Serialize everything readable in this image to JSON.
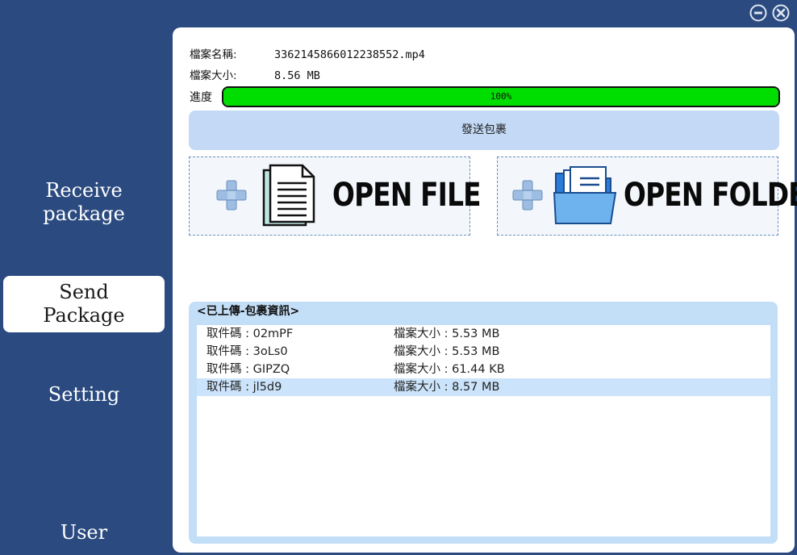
{
  "sidebar": {
    "items": [
      {
        "line1": "Receive",
        "line2": "package"
      },
      {
        "line1": "Send",
        "line2": "Package"
      },
      {
        "line1": "Setting"
      },
      {
        "line1": "User"
      }
    ],
    "active_index": 1
  },
  "window": {
    "minimize_icon": "minus-circle-icon",
    "close_icon": "x-circle-icon"
  },
  "file_info": {
    "name_label": "檔案名稱:",
    "name_value": "3362145866012238552.mp4",
    "size_label": "檔案大小:",
    "size_value": "8.56 MB"
  },
  "progress": {
    "label": "進度",
    "value": 1.0,
    "text": "100%",
    "color": "#00dd00"
  },
  "send_button": {
    "label": "發送包裹"
  },
  "open_file": {
    "label": "OPEN FILE",
    "icon": "document-icon"
  },
  "open_folder": {
    "label": "OPEN FOLDER",
    "icon": "folder-icon"
  },
  "uploaded": {
    "title": "<已上傳-包裹資訊>",
    "rows": [
      {
        "code": "取件碼 : 02mPF",
        "size": "檔案大小 : 5.53 MB"
      },
      {
        "code": "取件碼 : 3oLs0",
        "size": "檔案大小 : 5.53 MB"
      },
      {
        "code": "取件碼 : GIPZQ",
        "size": "檔案大小 : 61.44 KB"
      },
      {
        "code": "取件碼 : jl5d9",
        "size": "檔案大小 : 8.57 MB"
      }
    ],
    "selected_index": 3
  },
  "colors": {
    "background": "#2b4b80",
    "panel": "#ffffff",
    "accent_light": "#c3d9f5"
  }
}
